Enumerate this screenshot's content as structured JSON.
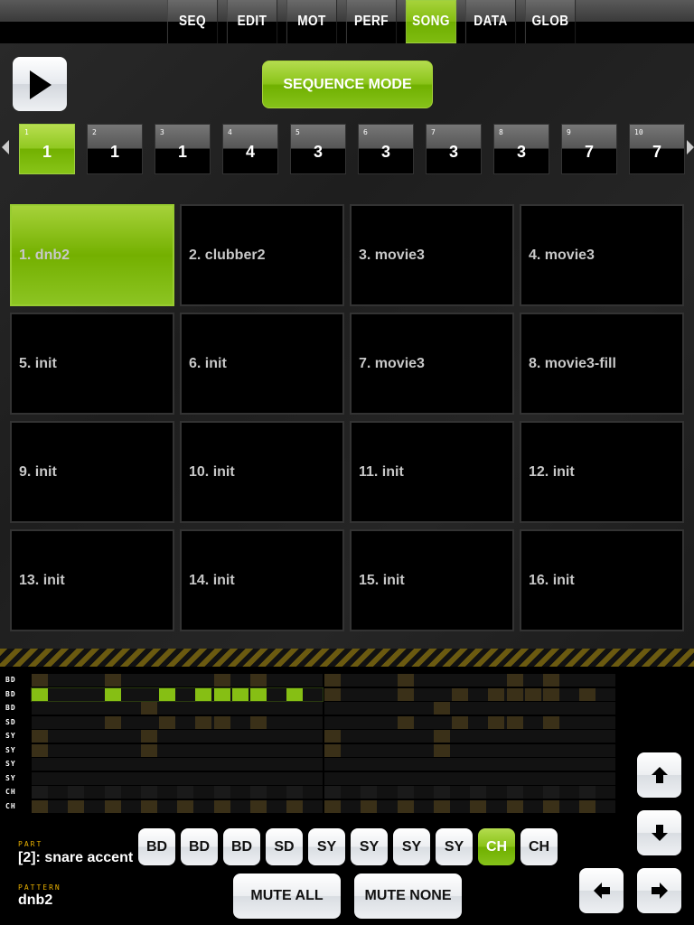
{
  "tabs": [
    {
      "label": "SEQ"
    },
    {
      "label": "EDIT"
    },
    {
      "label": "MOT"
    },
    {
      "label": "PERF"
    },
    {
      "label": "SONG",
      "active": true
    },
    {
      "label": "DATA"
    },
    {
      "label": "GLOB"
    }
  ],
  "sequence_mode_label": "SEQUENCE MODE",
  "song_chain": [
    {
      "n": "1",
      "v": "1",
      "active": true
    },
    {
      "n": "2",
      "v": "1"
    },
    {
      "n": "3",
      "v": "1"
    },
    {
      "n": "4",
      "v": "4"
    },
    {
      "n": "5",
      "v": "3"
    },
    {
      "n": "6",
      "v": "3"
    },
    {
      "n": "7",
      "v": "3"
    },
    {
      "n": "8",
      "v": "3"
    },
    {
      "n": "9",
      "v": "7"
    },
    {
      "n": "10",
      "v": "7"
    }
  ],
  "patterns": [
    "1. dnb2",
    "2. clubber2",
    "3. movie3",
    "4. movie3",
    "5. init",
    "6. init",
    "7. movie3",
    "8. movie3-fill",
    "9. init",
    "10. init",
    "11. init",
    "12. init",
    "13. init",
    "14. init",
    "15. init",
    "16. init"
  ],
  "active_pattern": 0,
  "tracks": [
    {
      "label": "BD",
      "steps": [
        0,
        4,
        10,
        12
      ]
    },
    {
      "label": "BD",
      "steps": [
        0,
        4,
        7,
        9,
        10,
        11,
        12,
        14
      ],
      "current": true
    },
    {
      "label": "BD",
      "steps": [
        6
      ]
    },
    {
      "label": "SD",
      "steps": [
        4,
        7,
        9,
        10,
        12
      ]
    },
    {
      "label": "SY",
      "steps": [
        0,
        6
      ]
    },
    {
      "label": "SY",
      "steps": [
        0,
        6
      ]
    },
    {
      "label": "SY",
      "steps": []
    },
    {
      "label": "SY",
      "steps": []
    },
    {
      "label": "CH",
      "steps": [],
      "faint": [
        0,
        2,
        4,
        6,
        8,
        10,
        12,
        14
      ]
    },
    {
      "label": "CH",
      "steps": [
        0,
        2,
        4,
        6,
        8,
        10,
        12,
        14
      ]
    }
  ],
  "part_buttons": [
    {
      "label": "BD"
    },
    {
      "label": "BD"
    },
    {
      "label": "BD"
    },
    {
      "label": "SD"
    },
    {
      "label": "SY"
    },
    {
      "label": "SY"
    },
    {
      "label": "SY"
    },
    {
      "label": "SY"
    },
    {
      "label": "CH",
      "active": true
    },
    {
      "label": "CH"
    }
  ],
  "part": {
    "label": "PART",
    "value": "[2]: snare accent"
  },
  "pattern": {
    "label": "PATTERN",
    "value": "dnb2"
  },
  "mute_all": "MUTE ALL",
  "mute_none": "MUTE NONE",
  "colors": {
    "accent": "#7fbc10",
    "step_on": "#3a3018",
    "label_yellow": "#e8b000"
  }
}
